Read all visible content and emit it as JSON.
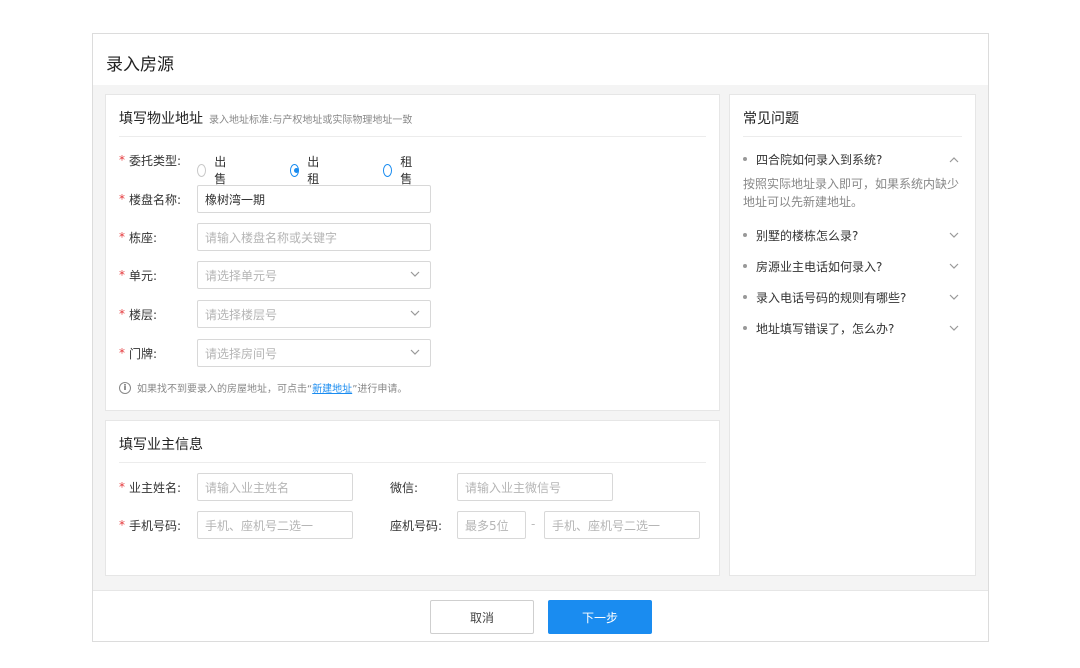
{
  "page": {
    "title": "录入房源"
  },
  "address_section": {
    "title": "填写物业地址",
    "subtitle": "录入地址标准:与产权地址或实际物理地址一致",
    "required_mark": "*",
    "entrust_type": {
      "label": "委托类型:",
      "options": [
        "出售",
        "出租",
        "租售"
      ],
      "selected": "出租"
    },
    "building_name": {
      "label": "楼盘名称:",
      "value": "橡树湾一期"
    },
    "block": {
      "label": "栋座:",
      "placeholder": "请输入楼盘名称或关键字"
    },
    "unit": {
      "label": "单元:",
      "placeholder": "请选择单元号"
    },
    "floor": {
      "label": "楼层:",
      "placeholder": "请选择楼层号"
    },
    "door": {
      "label": "门牌:",
      "placeholder": "请选择房间号"
    },
    "hint": {
      "before": "如果找不到要录入的房屋地址，可点击“",
      "link": "新建地址",
      "after": "”进行申请。"
    }
  },
  "owner_section": {
    "title": "填写业主信息",
    "owner_name": {
      "label": "业主姓名:",
      "placeholder": "请输入业主姓名"
    },
    "wechat": {
      "label": "微信:",
      "placeholder": "请输入业主微信号"
    },
    "mobile": {
      "label": "手机号码:",
      "placeholder": "手机、座机号二选一"
    },
    "landline": {
      "label": "座机号码:",
      "area_placeholder": "最多5位",
      "separator": "-",
      "placeholder": "手机、座机号二选一"
    }
  },
  "faq": {
    "title": "常见问题",
    "items": [
      {
        "question": "四合院如何录入到系统?",
        "expanded": true,
        "answer": "按照实际地址录入即可，如果系统内缺少地址可以先新建地址。"
      },
      {
        "question": "别墅的楼栋怎么录?",
        "expanded": false
      },
      {
        "question": "房源业主电话如何录入?",
        "expanded": false
      },
      {
        "question": "录入电话号码的规则有哪些?",
        "expanded": false
      },
      {
        "question": "地址填写错误了，怎么办?",
        "expanded": false
      }
    ]
  },
  "footer": {
    "cancel_label": "取消",
    "next_label": "下一步"
  },
  "colors": {
    "primary": "#1a8cf0",
    "required": "#e4393c",
    "placeholder": "#b5b5b5"
  }
}
